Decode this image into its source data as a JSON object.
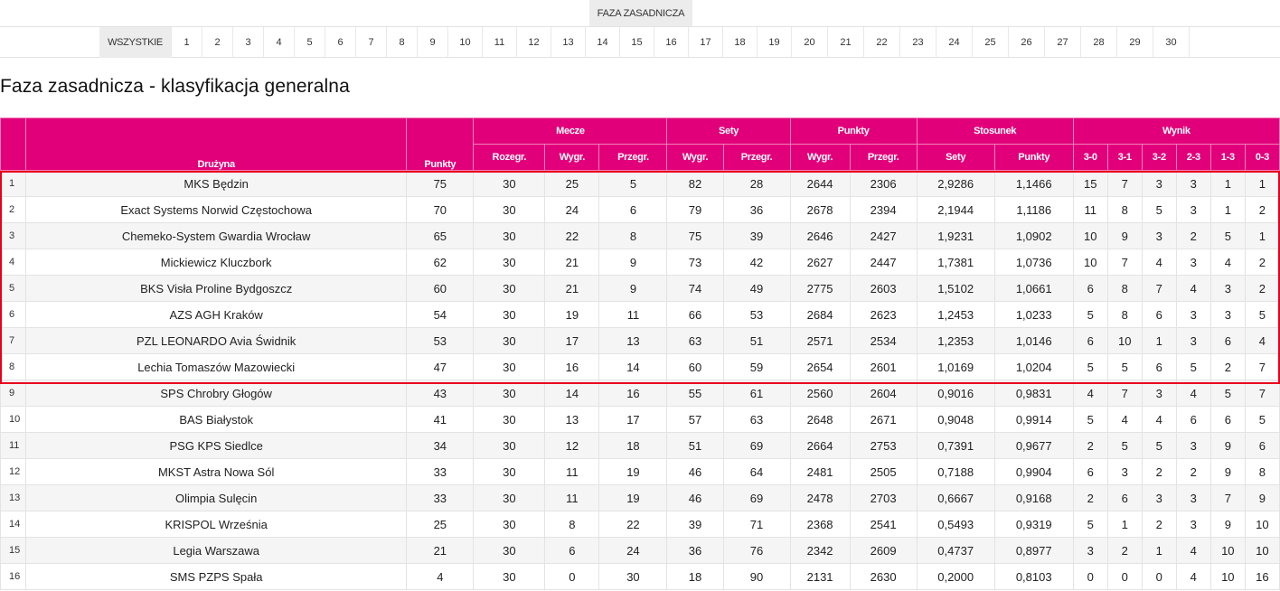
{
  "phase_tab": "FAZA ZASADNICZA",
  "rounds": [
    "WSZYSTKIE",
    "1",
    "2",
    "3",
    "4",
    "5",
    "6",
    "7",
    "8",
    "9",
    "10",
    "11",
    "12",
    "13",
    "14",
    "15",
    "16",
    "17",
    "18",
    "19",
    "20",
    "21",
    "22",
    "23",
    "24",
    "25",
    "26",
    "27",
    "28",
    "29",
    "30"
  ],
  "selected_round": "WSZYSTKIE",
  "title": "Faza zasadnicza - klasyfikacja generalna",
  "colors": {
    "accent": "#e2007a",
    "highlight_border": "#e8001c"
  },
  "headers": {
    "team": "Drużyna",
    "points": "Punkty",
    "groups": {
      "matches": "Mecze",
      "sets": "Sety",
      "points": "Punkty",
      "ratio": "Stosunek",
      "result": "Wynik"
    },
    "sub": {
      "matches_played": "Rozegr.",
      "matches_won": "Wygr.",
      "matches_lost": "Przegr.",
      "sets_won": "Wygr.",
      "sets_lost": "Przegr.",
      "points_won": "Wygr.",
      "points_lost": "Przegr.",
      "ratio_sets": "Sety",
      "ratio_points": "Punkty",
      "r30": "3-0",
      "r31": "3-1",
      "r32": "3-2",
      "r23": "2-3",
      "r13": "1-3",
      "r03": "0-3"
    }
  },
  "highlighted_rows": 8,
  "rows": [
    [
      "1",
      "MKS Będzin",
      "75",
      "30",
      "25",
      "5",
      "82",
      "28",
      "2644",
      "2306",
      "2,9286",
      "1,1466",
      "15",
      "7",
      "3",
      "3",
      "1",
      "1"
    ],
    [
      "2",
      "Exact Systems Norwid Częstochowa",
      "70",
      "30",
      "24",
      "6",
      "79",
      "36",
      "2678",
      "2394",
      "2,1944",
      "1,1186",
      "11",
      "8",
      "5",
      "3",
      "1",
      "2"
    ],
    [
      "3",
      "Chemeko-System Gwardia Wrocław",
      "65",
      "30",
      "22",
      "8",
      "75",
      "39",
      "2646",
      "2427",
      "1,9231",
      "1,0902",
      "10",
      "9",
      "3",
      "2",
      "5",
      "1"
    ],
    [
      "4",
      "Mickiewicz Kluczbork",
      "62",
      "30",
      "21",
      "9",
      "73",
      "42",
      "2627",
      "2447",
      "1,7381",
      "1,0736",
      "10",
      "7",
      "4",
      "3",
      "4",
      "2"
    ],
    [
      "5",
      "BKS Visła Proline Bydgoszcz",
      "60",
      "30",
      "21",
      "9",
      "74",
      "49",
      "2775",
      "2603",
      "1,5102",
      "1,0661",
      "6",
      "8",
      "7",
      "4",
      "3",
      "2"
    ],
    [
      "6",
      "AZS AGH Kraków",
      "54",
      "30",
      "19",
      "11",
      "66",
      "53",
      "2684",
      "2623",
      "1,2453",
      "1,0233",
      "5",
      "8",
      "6",
      "3",
      "3",
      "5"
    ],
    [
      "7",
      "PZL LEONARDO Avia Świdnik",
      "53",
      "30",
      "17",
      "13",
      "63",
      "51",
      "2571",
      "2534",
      "1,2353",
      "1,0146",
      "6",
      "10",
      "1",
      "3",
      "6",
      "4"
    ],
    [
      "8",
      "Lechia Tomaszów Mazowiecki",
      "47",
      "30",
      "16",
      "14",
      "60",
      "59",
      "2654",
      "2601",
      "1,0169",
      "1,0204",
      "5",
      "5",
      "6",
      "5",
      "2",
      "7"
    ],
    [
      "9",
      "SPS Chrobry Głogów",
      "43",
      "30",
      "14",
      "16",
      "55",
      "61",
      "2560",
      "2604",
      "0,9016",
      "0,9831",
      "4",
      "7",
      "3",
      "4",
      "5",
      "7"
    ],
    [
      "10",
      "BAS Białystok",
      "41",
      "30",
      "13",
      "17",
      "57",
      "63",
      "2648",
      "2671",
      "0,9048",
      "0,9914",
      "5",
      "4",
      "4",
      "6",
      "6",
      "5"
    ],
    [
      "11",
      "PSG KPS Siedlce",
      "34",
      "30",
      "12",
      "18",
      "51",
      "69",
      "2664",
      "2753",
      "0,7391",
      "0,9677",
      "2",
      "5",
      "5",
      "3",
      "9",
      "6"
    ],
    [
      "12",
      "MKST Astra Nowa Sól",
      "33",
      "30",
      "11",
      "19",
      "46",
      "64",
      "2481",
      "2505",
      "0,7188",
      "0,9904",
      "6",
      "3",
      "2",
      "2",
      "9",
      "8"
    ],
    [
      "13",
      "Olimpia Sulęcin",
      "33",
      "30",
      "11",
      "19",
      "46",
      "69",
      "2478",
      "2703",
      "0,6667",
      "0,9168",
      "2",
      "6",
      "3",
      "3",
      "7",
      "9"
    ],
    [
      "14",
      "KRISPOL Września",
      "25",
      "30",
      "8",
      "22",
      "39",
      "71",
      "2368",
      "2541",
      "0,5493",
      "0,9319",
      "5",
      "1",
      "2",
      "3",
      "9",
      "10"
    ],
    [
      "15",
      "Legia Warszawa",
      "21",
      "30",
      "6",
      "24",
      "36",
      "76",
      "2342",
      "2609",
      "0,4737",
      "0,8977",
      "3",
      "2",
      "1",
      "4",
      "10",
      "10"
    ],
    [
      "16",
      "SMS PZPS Spała",
      "4",
      "30",
      "0",
      "30",
      "18",
      "90",
      "2131",
      "2630",
      "0,2000",
      "0,8103",
      "0",
      "0",
      "0",
      "4",
      "10",
      "16"
    ]
  ]
}
